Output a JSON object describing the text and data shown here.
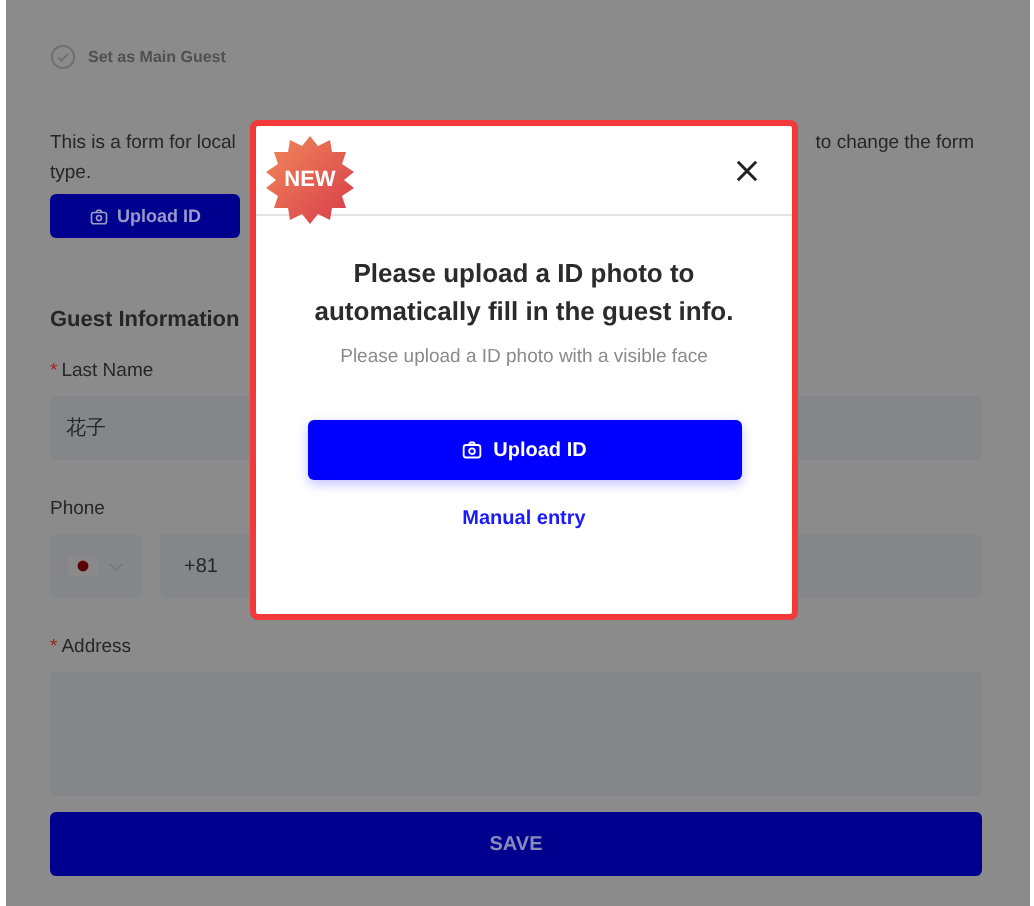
{
  "form": {
    "main_guest_option": {
      "label": "Set as Main Guest"
    },
    "intro_text": {
      "start": "This is a form for local",
      "end": "to change the form",
      "continuation": "type."
    },
    "upload_button": "Upload ID",
    "section_title": "Guest Information",
    "fields": [
      {
        "kind": "text",
        "marker": "*",
        "label": "Last Name",
        "value": "花子"
      },
      {
        "kind": "phone",
        "label": "Phone",
        "value": "+81"
      },
      {
        "kind": "textarea",
        "marker": "*",
        "label": "Address"
      }
    ],
    "save_button": "SAVE"
  },
  "dialog": {
    "badge": "NEW",
    "title": "Please upload a ID photo to automatically fill in the guest info.",
    "subtitle": "Please upload a ID photo with a visible face",
    "upload_button": "Upload ID",
    "link": "Manual entry"
  }
}
